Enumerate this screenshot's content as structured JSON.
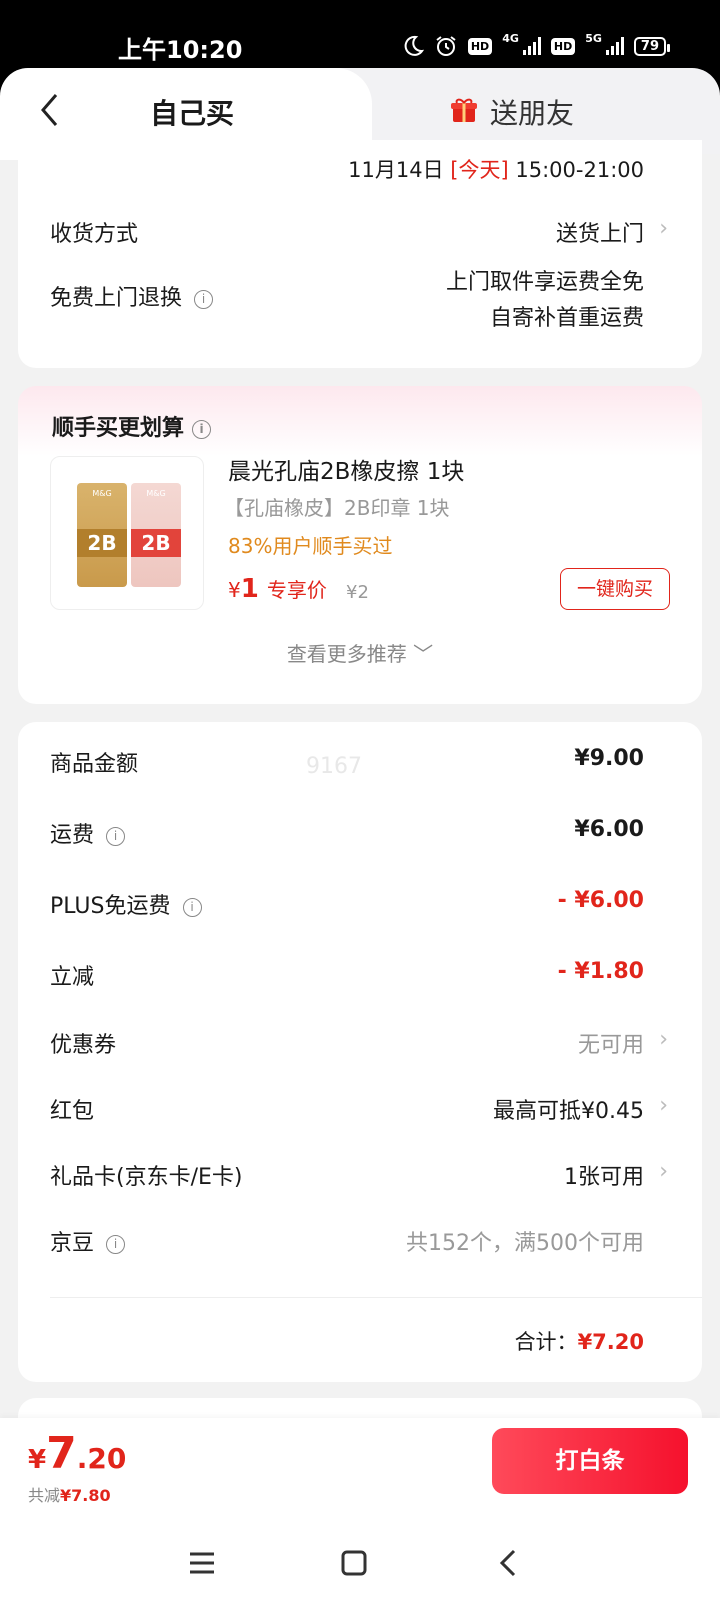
{
  "status_bar": {
    "time": "上午10:20",
    "net1": "4G",
    "net2": "5G",
    "battery": "79",
    "icons": [
      "moon-icon",
      "alarm-icon",
      "hd-icon",
      "signal-icon",
      "hd-icon",
      "signal-icon",
      "battery-icon"
    ]
  },
  "header": {
    "tab_self": "自己买",
    "tab_gift": "送朋友",
    "hd_label": "HD"
  },
  "delivery": {
    "date": "11月14日",
    "today": "[今天]",
    "window": "15:00-21:00",
    "method_label": "收货方式",
    "method_value": "送货上门",
    "return_label": "免费上门退换",
    "return_line1": "上门取件享运费全免",
    "return_line2": "自寄补首重运费"
  },
  "recommend": {
    "title": "顺手买更划算",
    "product_name": "晨光孔庙2B橡皮擦 1块",
    "product_spec": "【孔庙橡皮】2B印章 1块",
    "product_stat": "83%用户顺手买过",
    "price_symbol": "¥",
    "price": "1",
    "price_tag": "专享价",
    "orig_price": "¥2",
    "buy_label": "一键购买",
    "more_label": "查看更多推荐 ﹀",
    "eraser_text": "2B",
    "eraser_brand": "M&G"
  },
  "price_detail": {
    "watermark": "9167",
    "rows": [
      {
        "label": "商品金额",
        "value": "¥9.00"
      },
      {
        "label": "运费",
        "value": "¥6.00"
      },
      {
        "label": "PLUS免运费",
        "value": "- ¥6.00"
      },
      {
        "label": "立减",
        "value": "- ¥1.80"
      },
      {
        "label": "优惠券",
        "value": "无可用"
      },
      {
        "label": "红包",
        "value": "最高可抵¥0.45"
      },
      {
        "label": "礼品卡(京东卡/E卡)",
        "value": "1张可用"
      },
      {
        "label": "京豆",
        "value": "共152个，满500个可用"
      }
    ],
    "total_label": "合计：",
    "total_value": "¥7.20"
  },
  "bottom": {
    "yen": "¥",
    "int": "7",
    "dec": ".20",
    "saved_label": "共减",
    "saved_value": "¥7.80",
    "pay_label": "打白条"
  },
  "colors": {
    "accent": "#e1251b",
    "orange": "#e08a1e"
  }
}
